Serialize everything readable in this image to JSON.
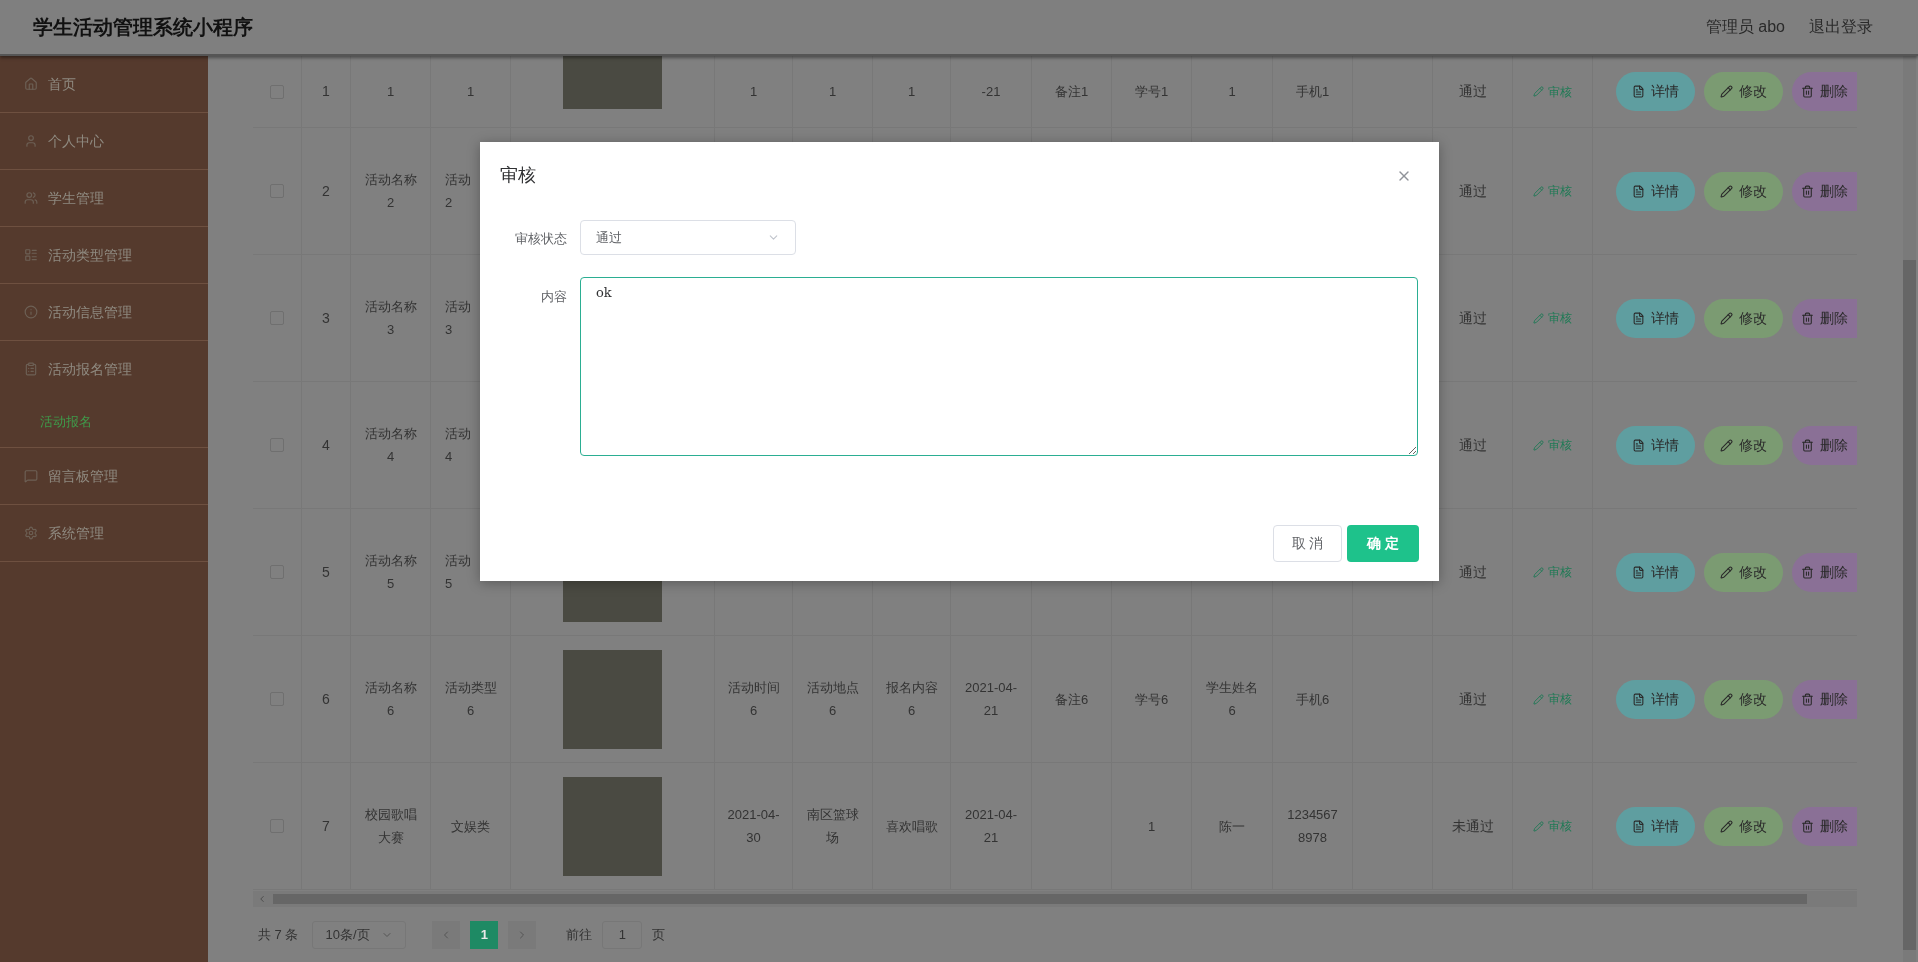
{
  "header": {
    "title": "学生活动管理系统小程序",
    "user": "管理员 abo",
    "logout": "退出登录"
  },
  "sidebar": {
    "items": [
      {
        "kind": "home",
        "label": "首页",
        "selected": false
      },
      {
        "kind": "person",
        "label": "个人中心",
        "selected": false
      },
      {
        "kind": "students",
        "label": "学生管理",
        "selected": false
      },
      {
        "kind": "types",
        "label": "活动类型管理",
        "selected": false
      },
      {
        "kind": "info",
        "label": "活动信息管理",
        "selected": false
      },
      {
        "kind": "signup",
        "label": "活动报名管理",
        "selected": false,
        "children": [
          {
            "label": "活动报名",
            "selected": true
          }
        ]
      },
      {
        "kind": "board",
        "label": "留言板管理",
        "selected": false
      },
      {
        "kind": "system",
        "label": "系统管理",
        "selected": false
      }
    ]
  },
  "table": {
    "rows": [
      {
        "checked": false,
        "index": "1",
        "cells": [
          "1",
          "1",
          "1",
          "1",
          "1",
          "-21",
          "备注1",
          "学号1",
          "1",
          "手机1"
        ],
        "status": "通过",
        "audit": "审核",
        "actions": [
          {
            "kind": "detail",
            "label": "详情"
          },
          {
            "kind": "edit",
            "label": "修改"
          },
          {
            "kind": "delete",
            "label": "删除"
          }
        ]
      },
      {
        "checked": false,
        "index": "2",
        "cells": [
          "活动名称2",
          [
            "活动",
            "2"
          ],
          null,
          null,
          null,
          null,
          null,
          null,
          null,
          null
        ],
        "status": "通过",
        "audit": "审核",
        "actions": [
          {
            "kind": "detail",
            "label": "详情"
          },
          {
            "kind": "edit",
            "label": "修改"
          },
          {
            "kind": "delete",
            "label": "删除"
          }
        ]
      },
      {
        "checked": false,
        "index": "3",
        "cells": [
          "活动名称3",
          [
            "活动",
            "3"
          ],
          null,
          null,
          null,
          null,
          null,
          null,
          null,
          null
        ],
        "status": "通过",
        "audit": "审核",
        "actions": [
          {
            "kind": "detail",
            "label": "详情"
          },
          {
            "kind": "edit",
            "label": "修改"
          },
          {
            "kind": "delete",
            "label": "删除"
          }
        ]
      },
      {
        "checked": false,
        "index": "4",
        "cells": [
          "活动名称4",
          [
            "活动",
            "4"
          ],
          null,
          null,
          null,
          null,
          null,
          null,
          null,
          null
        ],
        "status": "通过",
        "audit": "审核",
        "actions": [
          {
            "kind": "detail",
            "label": "详情"
          },
          {
            "kind": "edit",
            "label": "修改"
          },
          {
            "kind": "delete",
            "label": "删除"
          }
        ]
      },
      {
        "checked": false,
        "index": "5",
        "cells": [
          "活动名称5",
          [
            "活动",
            "5"
          ],
          null,
          null,
          null,
          null,
          null,
          null,
          null,
          null
        ],
        "status": "通过",
        "audit": "审核",
        "actions": [
          {
            "kind": "detail",
            "label": "详情"
          },
          {
            "kind": "edit",
            "label": "修改"
          },
          {
            "kind": "delete",
            "label": "删除"
          }
        ]
      },
      {
        "checked": false,
        "index": "6",
        "cells": [
          "活动名称6",
          "活动类型6",
          "活动时间6",
          "活动地点6",
          "报名内容6",
          "2021-04-21",
          "备注6",
          "学号6",
          "学生姓名6",
          "手机6"
        ],
        "status": "通过",
        "audit": "审核",
        "actions": [
          {
            "kind": "detail",
            "label": "详情"
          },
          {
            "kind": "edit",
            "label": "修改"
          },
          {
            "kind": "delete",
            "label": "删除"
          }
        ]
      },
      {
        "checked": false,
        "index": "7",
        "cells": [
          "校园歌唱大赛",
          "文娱类",
          "2021-04-30",
          "南区篮球场",
          "喜欢唱歌",
          "2021-04-21",
          null,
          "1",
          "陈一",
          "12345678978"
        ],
        "status": "未通过",
        "audit": "审核",
        "actions": [
          {
            "kind": "detail",
            "label": "详情"
          },
          {
            "kind": "edit",
            "label": "修改"
          },
          {
            "kind": "delete",
            "label": "删除"
          }
        ]
      }
    ]
  },
  "pagination": {
    "total": "共 7 条",
    "page_size": "10条/页",
    "pages": [
      {
        "label": "1",
        "selected": true
      }
    ],
    "goto_label": "前往",
    "goto_value": "1",
    "page_unit": "页"
  },
  "modal": {
    "title": "审核",
    "fields": [
      {
        "kind": "select",
        "label": "审核状态",
        "value": "通过"
      },
      {
        "kind": "textarea",
        "label": "内容",
        "value": "ok"
      }
    ],
    "buttons": [
      {
        "kind": "cancel",
        "label": "取 消"
      },
      {
        "kind": "primary",
        "label": "确 定"
      }
    ]
  }
}
